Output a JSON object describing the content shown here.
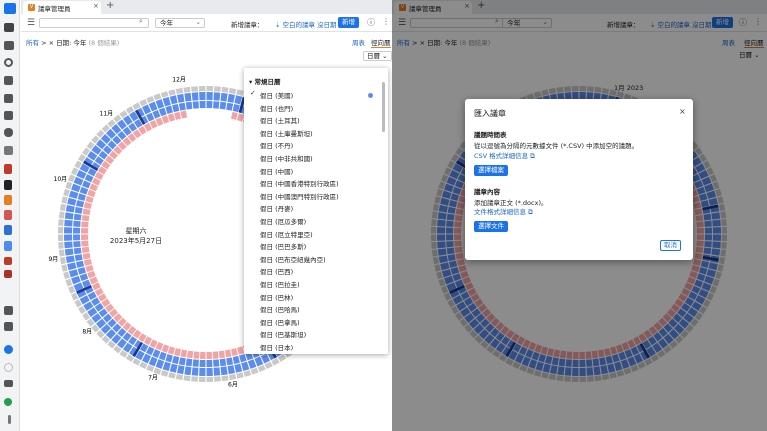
{
  "app": {
    "tab_title": "議章管理員",
    "tab_icon_letter": "V"
  },
  "toolbar": {
    "search_placeholder": "",
    "year_value": "今年",
    "new_label": "新增議章：",
    "blank_label": "空白的議章",
    "no_date_label": "沒日期",
    "new_button": "新增"
  },
  "subbar": {
    "all_label": "所有",
    "crumb_sep": ">",
    "filter_x": "×",
    "filter_label": "日期: 今年",
    "filter_hint": "(8 個結果)",
    "tab_week": "周表",
    "tab_annual": "徑向曆",
    "unit_select": "日曆"
  },
  "calendar": {
    "center_weekday": "星期六",
    "center_date": "2023年5月27日",
    "months_left": [
      "12月",
      "11月",
      "10月",
      "9月",
      "8月",
      "7月",
      "6月"
    ],
    "months_right": [
      "1月 2023"
    ]
  },
  "dropdown": {
    "header": "常規日曆",
    "items": [
      "假日 (美國)",
      "假日 (也門)",
      "假日 (土耳其)",
      "假日 (土庫曼斯坦)",
      "假日 (不丹)",
      "假日 (中非共和國)",
      "假日 (中國)",
      "假日 (中國香港特別行政區)",
      "假日 (中國澳門特別行政區)",
      "假日 (丹麥)",
      "假日 (厄瓜多爾)",
      "假日 (厄立特里亞)",
      "假日 (巴巴多斯)",
      "假日 (巴布亞紐幾內亞)",
      "假日 (巴西)",
      "假日 (巴拉圭)",
      "假日 (巴林)",
      "假日 (巴哈馬)",
      "假日 (巴拿馬)",
      "假日 (巴基斯坦)",
      "假日 (日本)"
    ]
  },
  "dialog": {
    "title": "匯入議章",
    "section1_title": "議題時間表",
    "section1_text": "從以逗號為分隔的元數據文件 (*.CSV) 中添加空的議題。",
    "section1_link": "CSV 格式詳細信息",
    "section1_button": "選擇檔案",
    "section2_title": "議章內容",
    "section2_text": "添加議章正文 (*.docx)。",
    "section2_link": "文件格式詳細信息",
    "section2_button": "選擇文件",
    "cancel": "取消"
  },
  "colors": {
    "accent": "#1a73e8",
    "ring_blue": "#5b8def",
    "ring_red": "#f2a3a3",
    "ring_gray": "#c9c9c9",
    "tab_orange": "#e67e22"
  }
}
